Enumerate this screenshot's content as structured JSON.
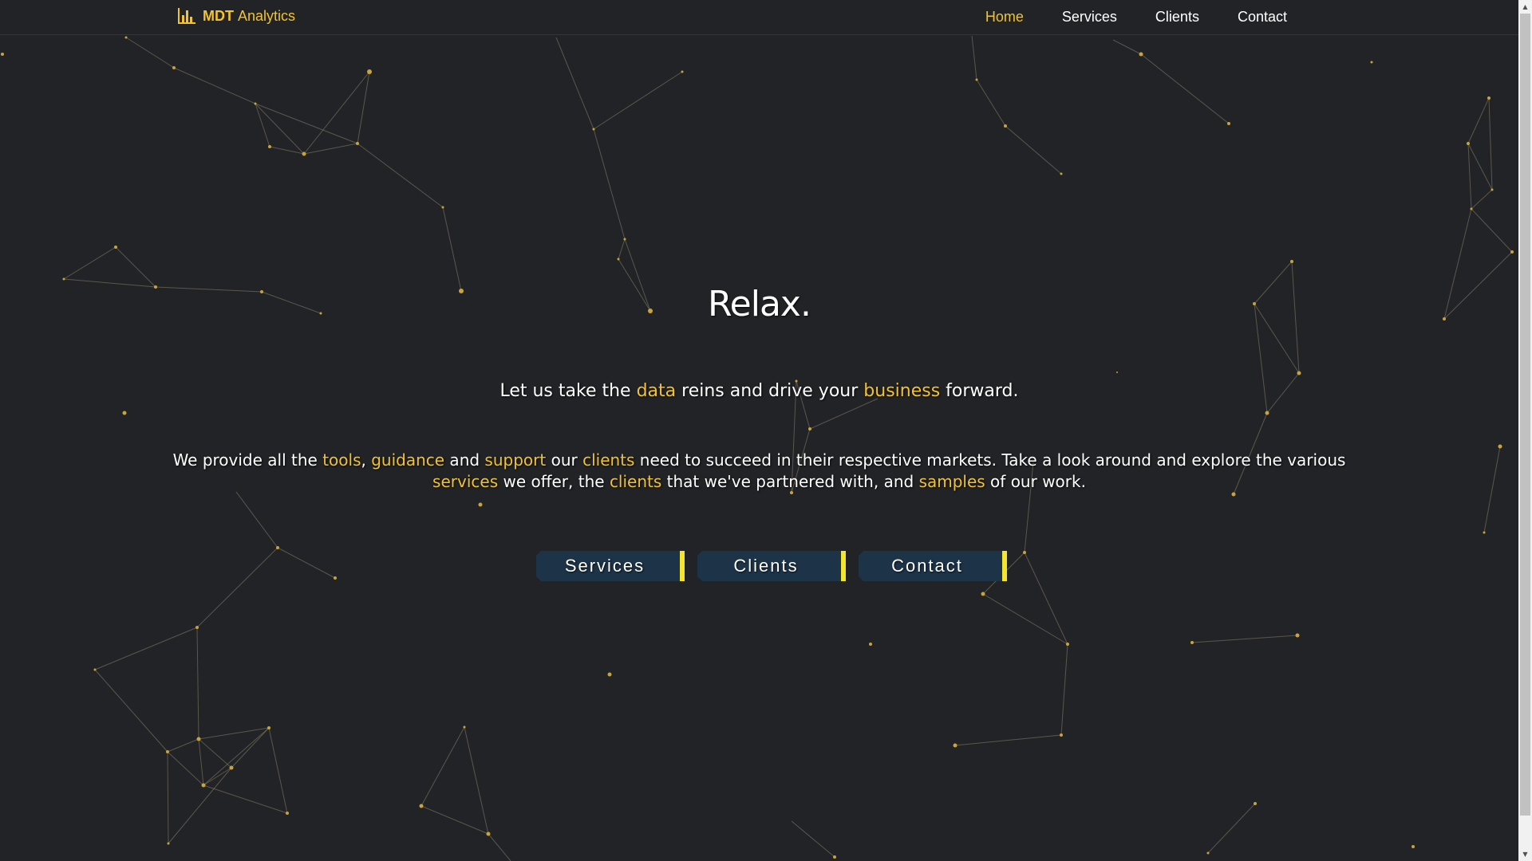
{
  "brand": {
    "bold": "MDT",
    "name": "Analytics",
    "icon": "bar-chart-icon"
  },
  "nav": {
    "items": [
      {
        "label": "Home",
        "active": true
      },
      {
        "label": "Services",
        "active": false
      },
      {
        "label": "Clients",
        "active": false
      },
      {
        "label": "Contact",
        "active": false
      }
    ]
  },
  "hero": {
    "title": "Relax.",
    "tagline": {
      "t1": "Let us take the ",
      "h1": "data",
      "t2": " reins and drive your ",
      "h2": "business",
      "t3": " forward."
    },
    "description": {
      "t1": "We provide all the ",
      "h1": "tools",
      "t2": ", ",
      "h2": "guidance",
      "t3": " and ",
      "h3": "support",
      "t4": " our ",
      "h4": "clients",
      "t5": " need to succeed in their respective markets. Take a look around and explore the various ",
      "h5": "services",
      "t6": " we offer, the ",
      "h6": "clients",
      "t7": " that we've partnered with, and ",
      "h7": "samples",
      "t8": " of our work."
    },
    "buttons": [
      "Services",
      "Clients",
      "Contact"
    ]
  },
  "colors": {
    "background": "#212326",
    "accent": "#f2c230",
    "button_bg": "#1d3448",
    "button_edge": "#f5e62b"
  }
}
